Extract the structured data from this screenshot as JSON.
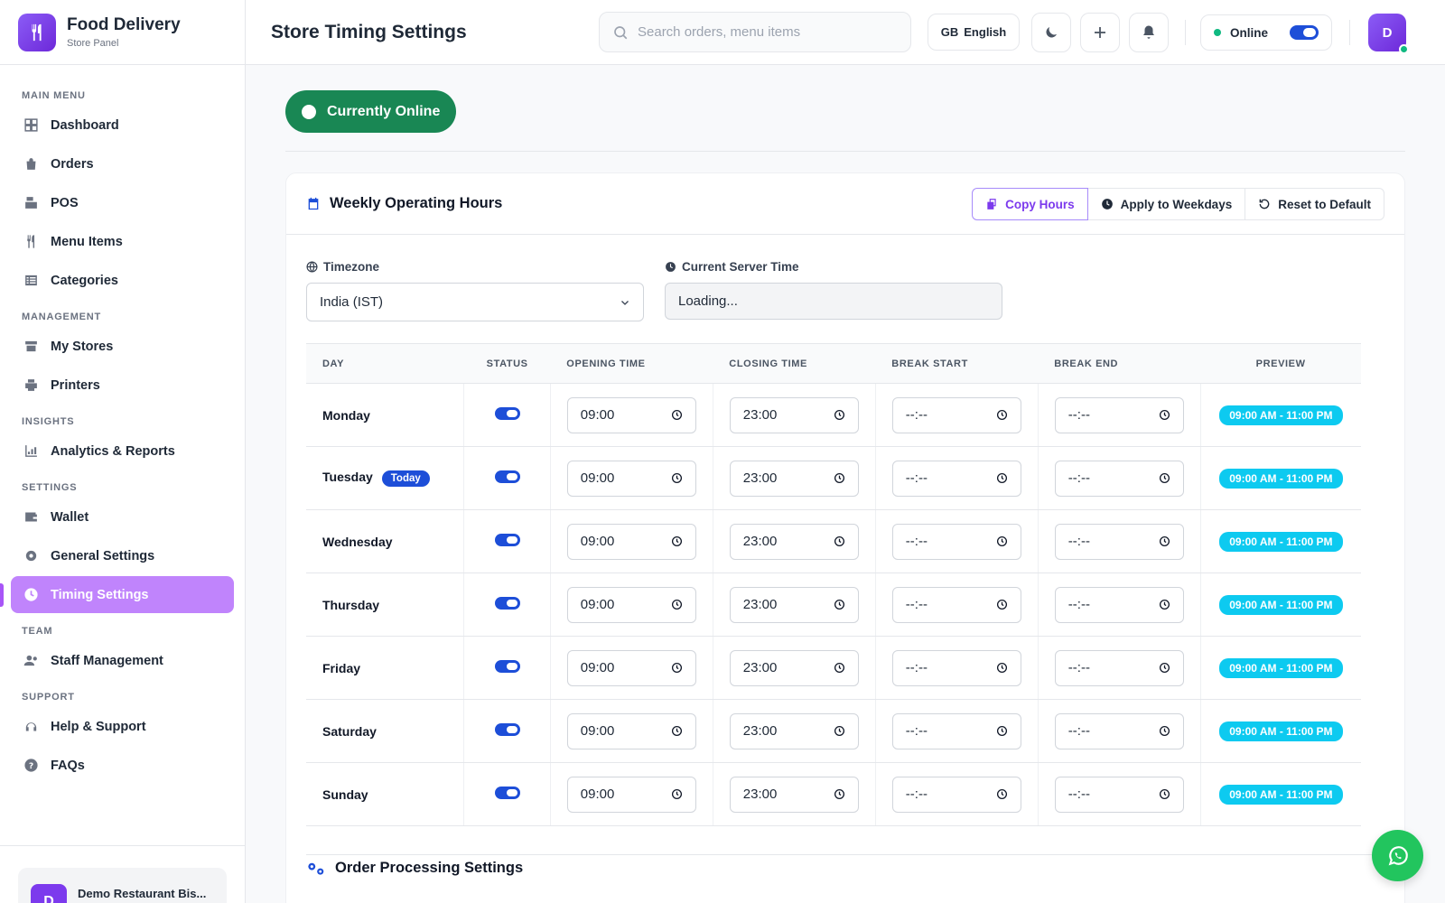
{
  "brand": {
    "title": "Food Delivery",
    "subtitle": "Store Panel"
  },
  "sidebar": {
    "sections": [
      {
        "label": "MAIN MENU",
        "items": [
          "Dashboard",
          "Orders",
          "POS",
          "Menu Items",
          "Categories"
        ]
      },
      {
        "label": "MANAGEMENT",
        "items": [
          "My Stores",
          "Printers"
        ]
      },
      {
        "label": "INSIGHTS",
        "items": [
          "Analytics & Reports"
        ]
      },
      {
        "label": "SETTINGS",
        "items": [
          "Wallet",
          "General Settings",
          "Timing Settings"
        ]
      },
      {
        "label": "TEAM",
        "items": [
          "Staff Management"
        ]
      },
      {
        "label": "SUPPORT",
        "items": [
          "Help & Support",
          "FAQs"
        ]
      }
    ],
    "active": "Timing Settings",
    "store": {
      "avatar": "D",
      "name": "Demo Restaurant Bis..."
    }
  },
  "header": {
    "title": "Store Timing Settings",
    "search_placeholder": "Search orders, menu items",
    "language_flag": "GB",
    "language": "English",
    "status": "Online",
    "avatar": "D"
  },
  "main": {
    "status_button": "Currently Online",
    "weekly": {
      "title": "Weekly Operating Hours",
      "actions": [
        "Copy Hours",
        "Apply to Weekdays",
        "Reset to Default"
      ],
      "timezone_label": "Timezone",
      "timezone_value": "India (IST)",
      "server_time_label": "Current Server Time",
      "server_time_value": "Loading...",
      "columns": [
        "DAY",
        "STATUS",
        "OPENING TIME",
        "CLOSING TIME",
        "BREAK START",
        "BREAK END",
        "PREVIEW"
      ],
      "today_badge": "Today",
      "rows": [
        {
          "day": "Monday",
          "enabled": true,
          "open": "09:00",
          "close": "23:00",
          "break_start": "--:--",
          "break_end": "--:--",
          "preview": "09:00 AM - 11:00 PM",
          "today": false
        },
        {
          "day": "Tuesday",
          "enabled": true,
          "open": "09:00",
          "close": "23:00",
          "break_start": "--:--",
          "break_end": "--:--",
          "preview": "09:00 AM - 11:00 PM",
          "today": true
        },
        {
          "day": "Wednesday",
          "enabled": true,
          "open": "09:00",
          "close": "23:00",
          "break_start": "--:--",
          "break_end": "--:--",
          "preview": "09:00 AM - 11:00 PM",
          "today": false
        },
        {
          "day": "Thursday",
          "enabled": true,
          "open": "09:00",
          "close": "23:00",
          "break_start": "--:--",
          "break_end": "--:--",
          "preview": "09:00 AM - 11:00 PM",
          "today": false
        },
        {
          "day": "Friday",
          "enabled": true,
          "open": "09:00",
          "close": "23:00",
          "break_start": "--:--",
          "break_end": "--:--",
          "preview": "09:00 AM - 11:00 PM",
          "today": false
        },
        {
          "day": "Saturday",
          "enabled": true,
          "open": "09:00",
          "close": "23:00",
          "break_start": "--:--",
          "break_end": "--:--",
          "preview": "09:00 AM - 11:00 PM",
          "today": false
        },
        {
          "day": "Sunday",
          "enabled": true,
          "open": "09:00",
          "close": "23:00",
          "break_start": "--:--",
          "break_end": "--:--",
          "preview": "09:00 AM - 11:00 PM",
          "today": false
        }
      ]
    },
    "order_processing_title": "Order Processing Settings"
  },
  "colors": {
    "accent": "#7c3aed",
    "online": "#198754",
    "preview": "#0dcaf0",
    "toggle": "#1d4ed8",
    "whatsapp": "#22c55e"
  },
  "icons": {
    "nav": [
      "grid-icon",
      "bag-icon",
      "pos-icon",
      "utensils-icon",
      "list-icon",
      "store-icon",
      "printer-icon",
      "chart-icon",
      "wallet-icon",
      "gear-icon",
      "clock-icon",
      "users-icon",
      "headset-icon",
      "question-icon"
    ]
  }
}
